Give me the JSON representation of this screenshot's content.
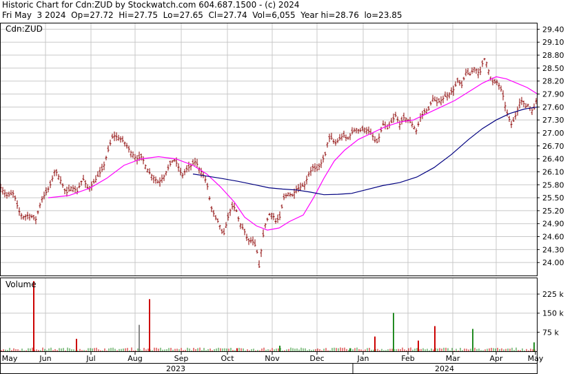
{
  "header": {
    "line1": "Historic Chart for Cdn:ZUD by Stockwatch.com 604.687.1500 - (c) 2024",
    "line2": "Fri May  3 2024  Op=27.72  Hi=27.75  Lo=27.65  Cl=27.74  Vol=6,055  Year hi=28.76  lo=23.85"
  },
  "price_panel": {
    "label": "Cdn:ZUD"
  },
  "volume_panel": {
    "label": "Volume"
  },
  "colors": {
    "bar": "#8b0000",
    "ma_short": "#ff00ff",
    "ma_long": "#000080",
    "vol_up": "#228b22",
    "vol_down": "#cc0000",
    "vol_neutral": "#888888",
    "grid": "#c8c8c8"
  },
  "chart_data": {
    "type": "ohlc",
    "title": "Historic Chart for Cdn:ZUD",
    "ylim": [
      23.7,
      29.55
    ],
    "y_ticks": [
      "29.40",
      "29.10",
      "28.80",
      "28.50",
      "28.20",
      "27.90",
      "27.60",
      "27.30",
      "27.00",
      "26.70",
      "26.40",
      "26.10",
      "25.80",
      "25.50",
      "25.20",
      "24.90",
      "24.60",
      "24.30",
      "24.00"
    ],
    "x_ticks": [
      "May",
      "Jun",
      "Jul",
      "Aug",
      "Sep",
      "Oct",
      "Nov",
      "Dec",
      "Jan",
      "Feb",
      "Mar",
      "Apr",
      "May"
    ],
    "years": [
      "2023",
      "2024"
    ],
    "volume_ticks": [
      "225 k",
      "150 k",
      "75 k"
    ],
    "volume_ylim": [
      0,
      290000
    ],
    "price_anchors": [
      [
        0,
        25.75
      ],
      [
        10,
        25.55
      ],
      [
        20,
        25.6
      ],
      [
        27,
        25.2
      ],
      [
        33,
        25.05
      ],
      [
        42,
        25.1
      ],
      [
        52,
        25.0
      ],
      [
        60,
        25.45
      ],
      [
        72,
        25.75
      ],
      [
        80,
        26.15
      ],
      [
        88,
        25.9
      ],
      [
        96,
        25.6
      ],
      [
        104,
        25.75
      ],
      [
        112,
        25.65
      ],
      [
        120,
        25.95
      ],
      [
        128,
        25.7
      ],
      [
        136,
        25.85
      ],
      [
        142,
        26.0
      ],
      [
        150,
        26.2
      ],
      [
        156,
        26.55
      ],
      [
        164,
        26.95
      ],
      [
        170,
        26.9
      ],
      [
        176,
        26.85
      ],
      [
        182,
        26.75
      ],
      [
        190,
        26.55
      ],
      [
        198,
        26.4
      ],
      [
        206,
        26.45
      ],
      [
        212,
        26.2
      ],
      [
        218,
        26.05
      ],
      [
        224,
        25.95
      ],
      [
        230,
        25.85
      ],
      [
        238,
        26.0
      ],
      [
        246,
        26.25
      ],
      [
        252,
        26.4
      ],
      [
        258,
        26.25
      ],
      [
        264,
        26.0
      ],
      [
        270,
        26.15
      ],
      [
        278,
        26.25
      ],
      [
        284,
        26.35
      ],
      [
        288,
        26.2
      ],
      [
        294,
        26.05
      ],
      [
        300,
        25.85
      ],
      [
        306,
        25.3
      ],
      [
        312,
        25.05
      ],
      [
        318,
        24.9
      ],
      [
        324,
        24.6
      ],
      [
        330,
        25.0
      ],
      [
        336,
        25.3
      ],
      [
        342,
        25.25
      ],
      [
        348,
        24.9
      ],
      [
        354,
        24.75
      ],
      [
        360,
        24.5
      ],
      [
        366,
        24.5
      ],
      [
        372,
        24.35
      ],
      [
        376,
        23.9
      ],
      [
        380,
        24.4
      ],
      [
        384,
        24.85
      ],
      [
        388,
        25.0
      ],
      [
        392,
        25.15
      ],
      [
        396,
        25.1
      ],
      [
        400,
        24.95
      ],
      [
        406,
        25.05
      ],
      [
        412,
        25.5
      ],
      [
        418,
        25.6
      ],
      [
        424,
        25.55
      ],
      [
        430,
        25.7
      ],
      [
        436,
        25.75
      ],
      [
        442,
        25.8
      ],
      [
        448,
        26.05
      ],
      [
        454,
        26.2
      ],
      [
        460,
        26.15
      ],
      [
        466,
        26.3
      ],
      [
        472,
        26.5
      ],
      [
        476,
        26.85
      ],
      [
        480,
        26.9
      ],
      [
        486,
        26.75
      ],
      [
        492,
        26.85
      ],
      [
        498,
        26.95
      ],
      [
        504,
        26.85
      ],
      [
        510,
        27.0
      ],
      [
        516,
        27.1
      ],
      [
        522,
        27.05
      ],
      [
        528,
        27.1
      ],
      [
        534,
        27.05
      ],
      [
        540,
        26.95
      ],
      [
        546,
        26.75
      ],
      [
        550,
        26.9
      ],
      [
        556,
        27.2
      ],
      [
        562,
        27.1
      ],
      [
        568,
        27.25
      ],
      [
        574,
        27.4
      ],
      [
        580,
        27.2
      ],
      [
        586,
        27.35
      ],
      [
        592,
        27.3
      ],
      [
        598,
        27.2
      ],
      [
        604,
        27.05
      ],
      [
        610,
        27.35
      ],
      [
        616,
        27.5
      ],
      [
        622,
        27.55
      ],
      [
        628,
        27.8
      ],
      [
        634,
        27.7
      ],
      [
        640,
        27.75
      ],
      [
        646,
        27.85
      ],
      [
        652,
        27.9
      ],
      [
        658,
        28.0
      ],
      [
        664,
        28.2
      ],
      [
        670,
        28.1
      ],
      [
        676,
        28.4
      ],
      [
        682,
        28.35
      ],
      [
        688,
        28.5
      ],
      [
        692,
        28.45
      ],
      [
        696,
        28.35
      ],
      [
        700,
        28.6
      ],
      [
        704,
        28.75
      ],
      [
        708,
        28.5
      ],
      [
        712,
        28.25
      ],
      [
        716,
        28.15
      ],
      [
        720,
        28.2
      ],
      [
        726,
        28.05
      ],
      [
        730,
        27.85
      ],
      [
        734,
        27.55
      ],
      [
        738,
        27.35
      ],
      [
        742,
        27.2
      ],
      [
        746,
        27.3
      ],
      [
        750,
        27.5
      ],
      [
        754,
        27.7
      ],
      [
        758,
        27.75
      ],
      [
        762,
        27.6
      ],
      [
        766,
        27.65
      ],
      [
        770,
        27.55
      ],
      [
        774,
        27.5
      ],
      [
        778,
        27.74
      ]
    ],
    "ma_short": [
      [
        70,
        25.5
      ],
      [
        100,
        25.55
      ],
      [
        130,
        25.72
      ],
      [
        155,
        25.95
      ],
      [
        180,
        26.25
      ],
      [
        205,
        26.4
      ],
      [
        230,
        26.45
      ],
      [
        255,
        26.4
      ],
      [
        280,
        26.25
      ],
      [
        300,
        26.05
      ],
      [
        320,
        25.75
      ],
      [
        340,
        25.4
      ],
      [
        355,
        25.05
      ],
      [
        372,
        24.85
      ],
      [
        388,
        24.75
      ],
      [
        405,
        24.8
      ],
      [
        420,
        24.95
      ],
      [
        440,
        25.1
      ],
      [
        455,
        25.5
      ],
      [
        470,
        25.95
      ],
      [
        485,
        26.35
      ],
      [
        500,
        26.6
      ],
      [
        520,
        26.85
      ],
      [
        540,
        27.0
      ],
      [
        560,
        27.15
      ],
      [
        580,
        27.25
      ],
      [
        600,
        27.3
      ],
      [
        620,
        27.45
      ],
      [
        640,
        27.6
      ],
      [
        660,
        27.75
      ],
      [
        680,
        27.95
      ],
      [
        700,
        28.15
      ],
      [
        720,
        28.3
      ],
      [
        735,
        28.25
      ],
      [
        750,
        28.15
      ],
      [
        765,
        28.05
      ],
      [
        780,
        27.9
      ]
    ],
    "ma_long": [
      [
        280,
        26.05
      ],
      [
        300,
        26.0
      ],
      [
        320,
        25.95
      ],
      [
        345,
        25.88
      ],
      [
        370,
        25.8
      ],
      [
        390,
        25.73
      ],
      [
        410,
        25.7
      ],
      [
        430,
        25.68
      ],
      [
        450,
        25.63
      ],
      [
        470,
        25.57
      ],
      [
        490,
        25.58
      ],
      [
        510,
        25.6
      ],
      [
        530,
        25.68
      ],
      [
        555,
        25.78
      ],
      [
        580,
        25.85
      ],
      [
        605,
        25.98
      ],
      [
        630,
        26.2
      ],
      [
        655,
        26.5
      ],
      [
        680,
        26.85
      ],
      [
        700,
        27.1
      ],
      [
        720,
        27.3
      ],
      [
        740,
        27.45
      ],
      [
        760,
        27.55
      ],
      [
        780,
        27.6
      ]
    ],
    "volume": [
      [
        49,
        276000,
        "d"
      ],
      [
        111,
        49000,
        "d"
      ],
      [
        202,
        104000,
        "n"
      ],
      [
        217,
        205000,
        "d"
      ],
      [
        344,
        12000,
        "d"
      ],
      [
        406,
        22000,
        "u"
      ],
      [
        508,
        12000,
        "u"
      ],
      [
        544,
        58000,
        "d"
      ],
      [
        571,
        151000,
        "u"
      ],
      [
        607,
        42000,
        "d"
      ],
      [
        631,
        99000,
        "d"
      ],
      [
        686,
        88000,
        "u"
      ],
      [
        775,
        35000,
        "u"
      ]
    ]
  }
}
